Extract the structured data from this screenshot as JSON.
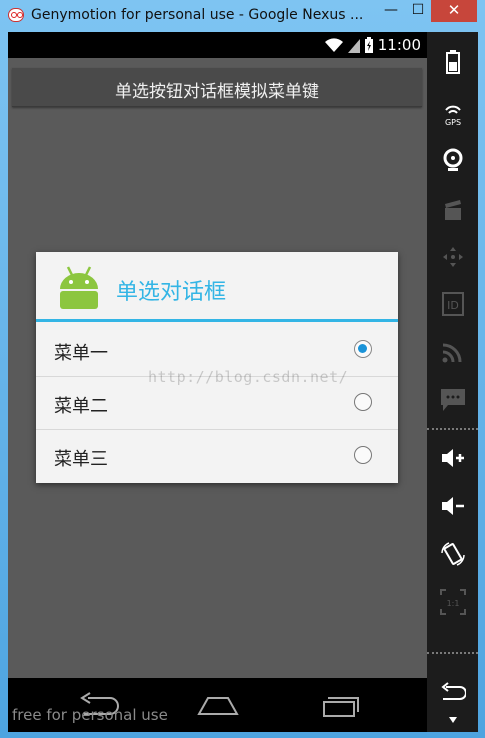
{
  "window": {
    "title": "Genymotion for personal use - Google Nexus ...",
    "minimize": "—",
    "maximize": "☐",
    "close": "✕"
  },
  "statusbar": {
    "time": "11:00"
  },
  "actionbar": {
    "title": "单选按钮对话框模拟菜单键"
  },
  "dialog": {
    "title": "单选对话框",
    "options": [
      {
        "label": "菜单一",
        "checked": true
      },
      {
        "label": "菜单二",
        "checked": false
      },
      {
        "label": "菜单三",
        "checked": false
      }
    ],
    "accent": "#33b5e5"
  },
  "watermark": "http://blog.csdn.net/",
  "footer": {
    "license": "free for personal use"
  },
  "sidebar": {
    "gps_label": "GPS",
    "id_label": "ID",
    "scale_label": "1:1",
    "icons": [
      "battery-icon",
      "gps-icon",
      "camera-icon",
      "clapper-icon",
      "dpad-icon",
      "id-icon",
      "cast-icon",
      "sms-icon",
      "volume-up-icon",
      "volume-down-icon",
      "rotate-icon",
      "scale-icon",
      "back-icon",
      "menu-arrow-icon"
    ]
  }
}
